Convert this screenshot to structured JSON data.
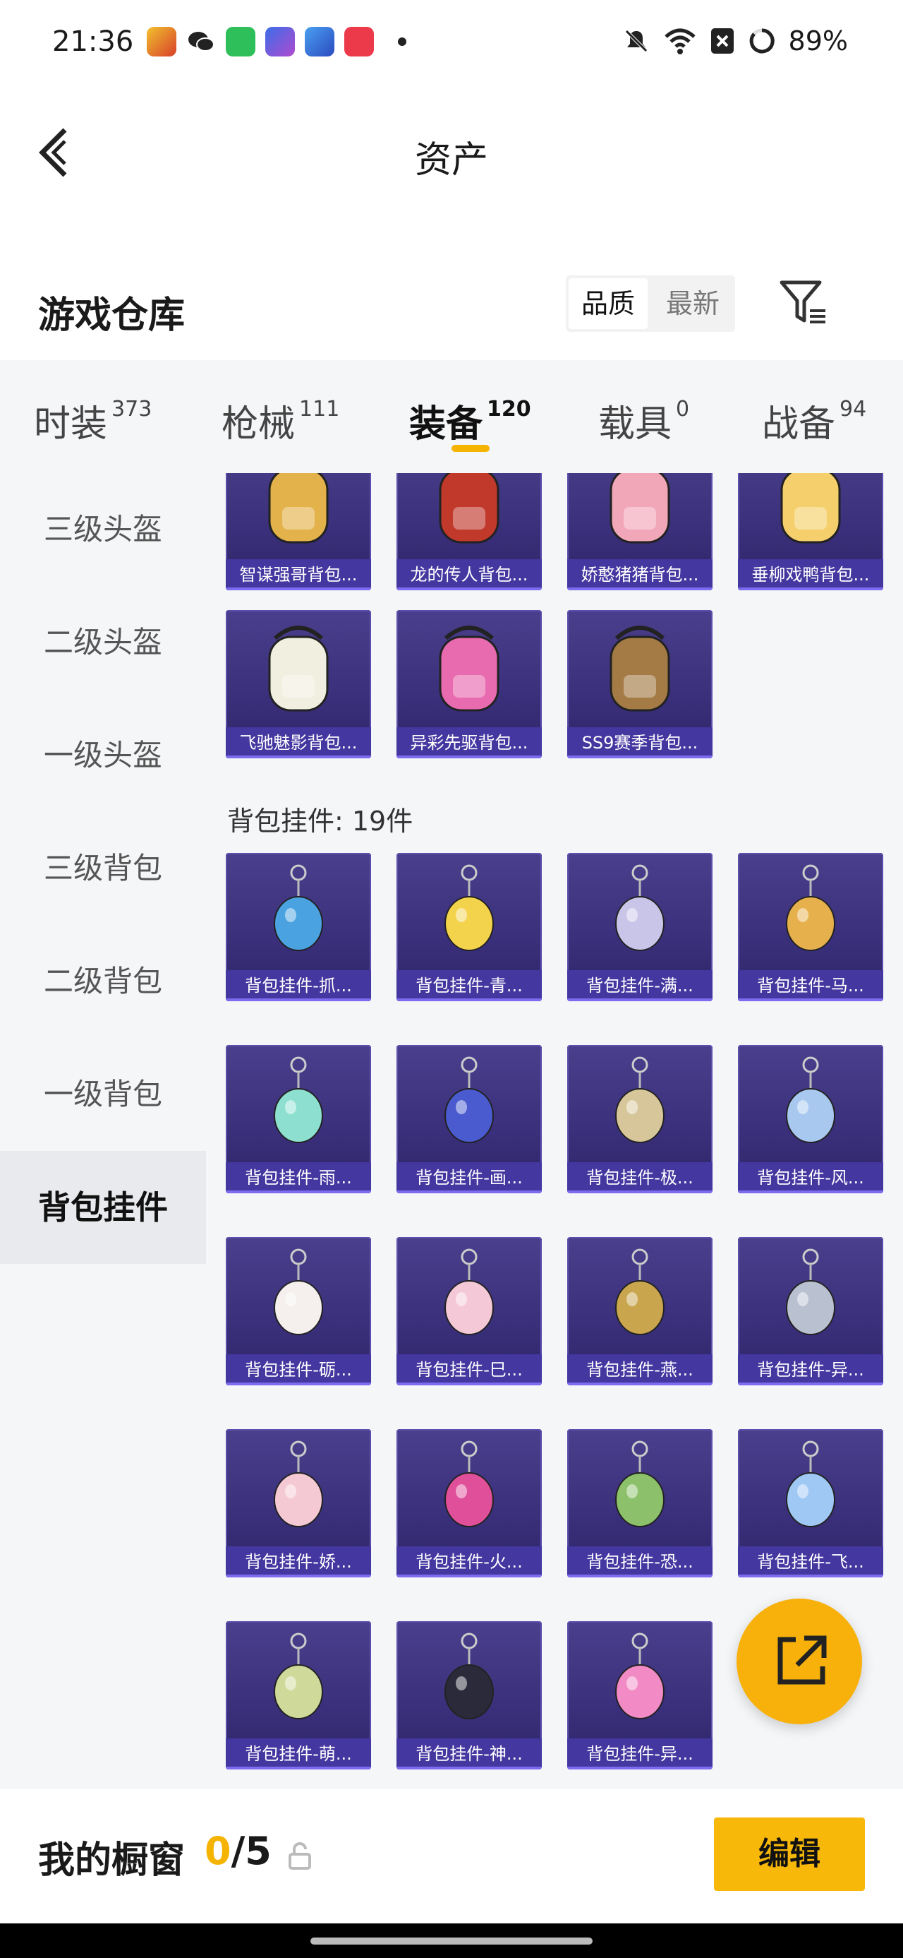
{
  "status_bar": {
    "time": "21:36",
    "battery": "89%"
  },
  "header": {
    "title": "资产"
  },
  "warehouse": {
    "title": "游戏仓库",
    "sort_quality": "品质",
    "sort_latest": "最新"
  },
  "tabs": [
    {
      "label": "时装",
      "count": "373"
    },
    {
      "label": "枪械",
      "count": "111"
    },
    {
      "label": "装备",
      "count": "120"
    },
    {
      "label": "载具",
      "count": "0"
    },
    {
      "label": "战备",
      "count": "94"
    }
  ],
  "sidebar": {
    "items": [
      {
        "label": "三级头盔"
      },
      {
        "label": "二级头盔"
      },
      {
        "label": "一级头盔"
      },
      {
        "label": "三级背包"
      },
      {
        "label": "二级背包"
      },
      {
        "label": "一级背包"
      },
      {
        "label": "背包挂件"
      }
    ]
  },
  "backpacks": [
    {
      "name": "智谋强哥背包...",
      "color": "#e3b24a"
    },
    {
      "name": "龙的传人背包...",
      "color": "#c0392b"
    },
    {
      "name": "娇憨猪猪背包...",
      "color": "#f2a7b8"
    },
    {
      "name": "垂柳戏鸭背包...",
      "color": "#f5cf6b"
    },
    {
      "name": "飞驰魅影背包...",
      "color": "#f1efe0"
    },
    {
      "name": "异彩先驱背包...",
      "color": "#e86bb0"
    },
    {
      "name": "SS9赛季背包...",
      "color": "#a57b45"
    }
  ],
  "pendants_section": "背包挂件: 19件",
  "pendants": [
    {
      "name": "背包挂件-抓...",
      "color": "#4aa3e0"
    },
    {
      "name": "背包挂件-青...",
      "color": "#f3d24c"
    },
    {
      "name": "背包挂件-满...",
      "color": "#c9c5e8"
    },
    {
      "name": "背包挂件-马...",
      "color": "#e6b04d"
    },
    {
      "name": "背包挂件-雨...",
      "color": "#8de0d0"
    },
    {
      "name": "背包挂件-画...",
      "color": "#4a5bd0"
    },
    {
      "name": "背包挂件-极...",
      "color": "#d8c69b"
    },
    {
      "name": "背包挂件-风...",
      "color": "#a8c8f0"
    },
    {
      "name": "背包挂件-砺...",
      "color": "#f5f0ee"
    },
    {
      "name": "背包挂件-巳...",
      "color": "#f4c8d6"
    },
    {
      "name": "背包挂件-燕...",
      "color": "#c9a54e"
    },
    {
      "name": "背包挂件-异...",
      "color": "#b9c0d0"
    },
    {
      "name": "背包挂件-娇...",
      "color": "#f5c9d4"
    },
    {
      "name": "背包挂件-火...",
      "color": "#e04f9a"
    },
    {
      "name": "背包挂件-恐...",
      "color": "#8cc06a"
    },
    {
      "name": "背包挂件-飞...",
      "color": "#9fc8f5"
    },
    {
      "name": "背包挂件-萌...",
      "color": "#cfd99a"
    },
    {
      "name": "背包挂件-神...",
      "color": "#2a2a3a"
    },
    {
      "name": "背包挂件-异...",
      "color": "#f18ac5"
    }
  ],
  "showcase": {
    "title": "我的橱窗",
    "current": "0",
    "total": "/5",
    "edit_label": "编辑"
  }
}
